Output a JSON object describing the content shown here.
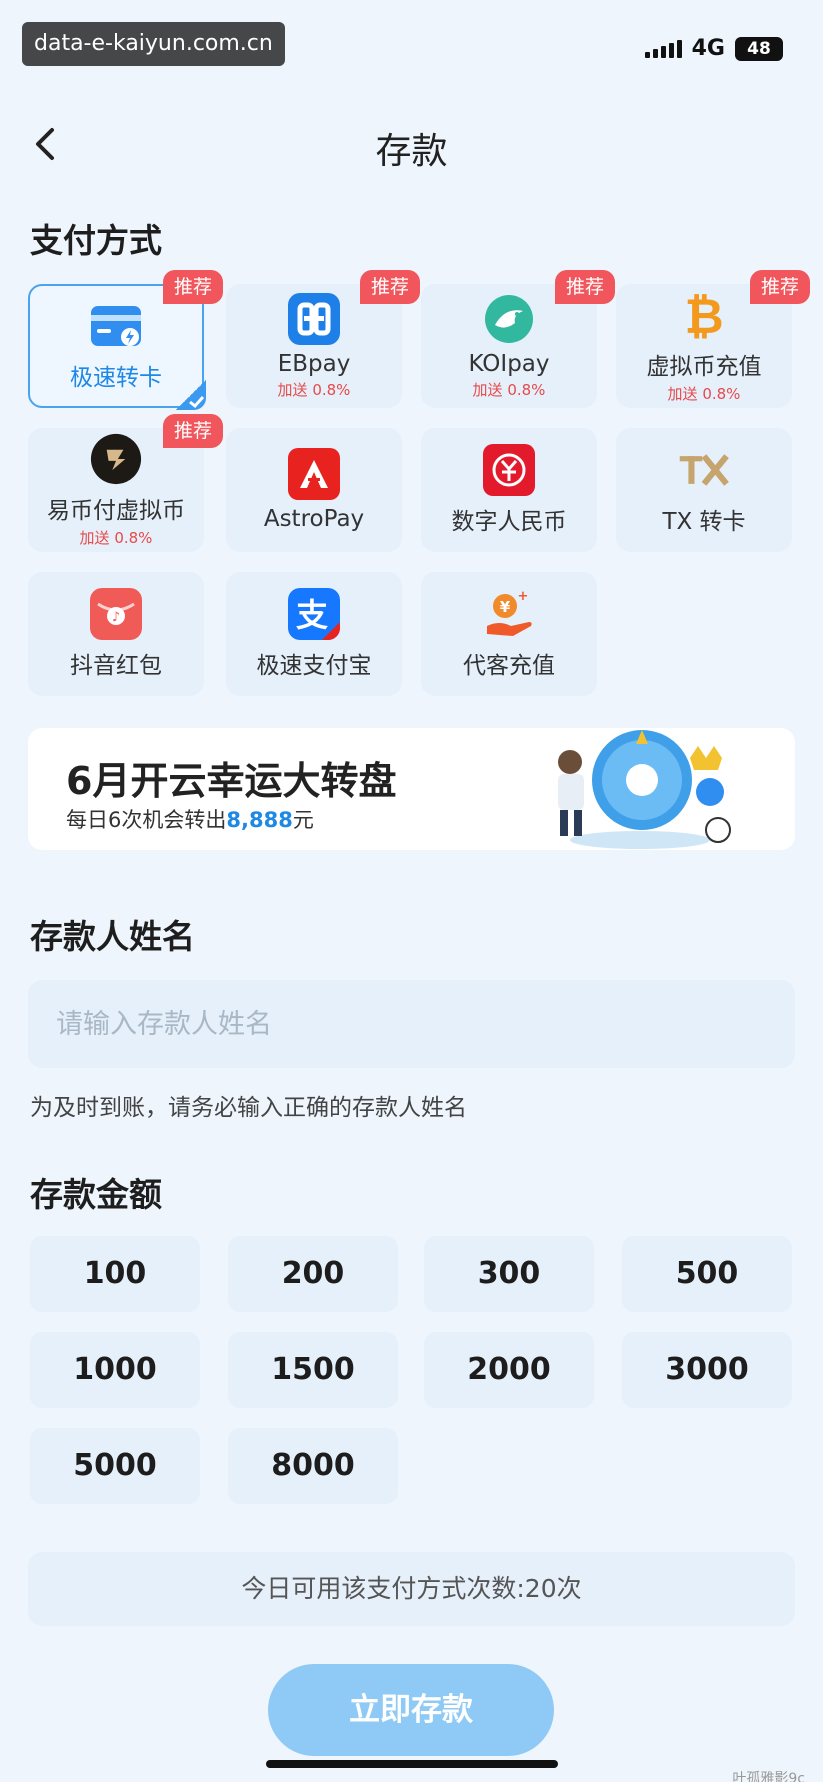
{
  "status_bar": {
    "watermark": "data-e-kaiyun.com.cn",
    "network": "4G",
    "battery": "48"
  },
  "header": {
    "title": "存款"
  },
  "payment": {
    "section_title": "支付方式",
    "methods": [
      {
        "name": "极速转卡",
        "bonus": "",
        "badge": "推荐",
        "icon": "bank-card-icon",
        "selected": true
      },
      {
        "name": "EBpay",
        "bonus": "加送 0.8%",
        "badge": "推荐",
        "icon": "ebpay-icon"
      },
      {
        "name": "KOIpay",
        "bonus": "加送 0.8%",
        "badge": "推荐",
        "icon": "koi-fish-icon"
      },
      {
        "name": "虚拟币充值",
        "bonus": "加送 0.8%",
        "badge": "推荐",
        "icon": "bitcoin-icon"
      },
      {
        "name": "易币付虚拟币",
        "bonus": "加送 0.8%",
        "badge": "推荐",
        "icon": "ebifu-icon"
      },
      {
        "name": "AstroPay",
        "bonus": "",
        "badge": "",
        "icon": "astropay-icon"
      },
      {
        "name": "数字人民币",
        "bonus": "",
        "badge": "",
        "icon": "digital-rmb-icon"
      },
      {
        "name": "TX 转卡",
        "bonus": "",
        "badge": "",
        "icon": "tx-icon"
      },
      {
        "name": "抖音红包",
        "bonus": "",
        "badge": "",
        "icon": "douyin-red-packet-icon"
      },
      {
        "name": "极速支付宝",
        "bonus": "",
        "badge": "",
        "icon": "alipay-icon"
      },
      {
        "name": "代客充值",
        "bonus": "",
        "badge": "",
        "icon": "agent-recharge-icon"
      }
    ]
  },
  "banner": {
    "title": "6月开云幸运大转盘",
    "subtitle_prefix": "每日6次机会转出",
    "subtitle_amount": "8,888",
    "subtitle_suffix": "元"
  },
  "depositor": {
    "section_title": "存款人姓名",
    "placeholder": "请输入存款人姓名",
    "value": "",
    "hint": "为及时到账，请务必输入正确的存款人姓名"
  },
  "amount": {
    "section_title": "存款金额",
    "options": [
      "100",
      "200",
      "300",
      "500",
      "1000",
      "1500",
      "2000",
      "3000",
      "5000",
      "8000"
    ]
  },
  "usage_text": "今日可用该支付方式次数:20次",
  "submit_label": "立即存款",
  "corner_watermark": "叶孤雅影9c",
  "colors": {
    "accent": "#1e88e5",
    "badge": "#f0565b",
    "button": "#8fcaf6",
    "bonus": "#e64a4a"
  }
}
